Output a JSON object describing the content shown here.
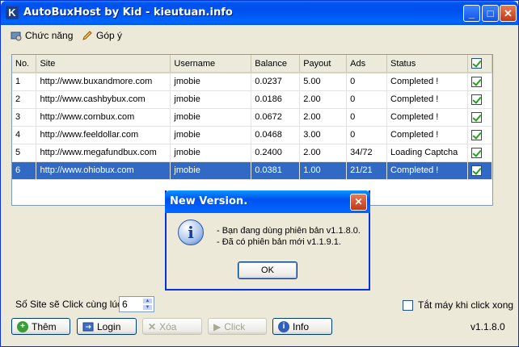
{
  "window": {
    "title": "AutoBuxHost by Kid - kieutuan.info",
    "icon_letter": "K"
  },
  "menu": {
    "items": [
      {
        "label": "Chức năng"
      },
      {
        "label": "Góp ý"
      }
    ]
  },
  "table": {
    "headers": [
      "No.",
      "Site",
      "Username",
      "Balance",
      "Payout",
      "Ads",
      "Status"
    ],
    "rows": [
      [
        "1",
        "http://www.buxandmore.com",
        "jmobie",
        "0.0237",
        "5.00",
        "0",
        "Completed !"
      ],
      [
        "2",
        "http://www.cashbybux.com",
        "jmobie",
        "0.0186",
        "2.00",
        "0",
        "Completed !"
      ],
      [
        "3",
        "http://www.cornbux.com",
        "jmobie",
        "0.0672",
        "2.00",
        "0",
        "Completed !"
      ],
      [
        "4",
        "http://www.feeldollar.com",
        "jmobie",
        "0.0468",
        "3.00",
        "0",
        "Completed !"
      ],
      [
        "5",
        "http://www.megafundbux.com",
        "jmobie",
        "0.2400",
        "2.00",
        "34/72",
        "Loading Captcha"
      ],
      [
        "6",
        "http://www.ohiobux.com",
        "jmobie",
        "0.0381",
        "1.00",
        "21/21",
        "Completed !"
      ]
    ],
    "selected_row": 6
  },
  "dialog": {
    "title": "New Version.",
    "line1": "- Bạn đang dùng phiên bản v1.1.8.0.",
    "line2": "- Đã có phiên bản mới v1.1.9.1.",
    "ok_label": "OK"
  },
  "footer": {
    "sites_label": "Số Site sẽ Click cùng lúc:",
    "sites_value": "6",
    "shutdown_label": "Tắt máy khi click xong",
    "buttons": {
      "add": "Thêm",
      "login": "Login",
      "delete": "Xóa",
      "click": "Click",
      "info": "Info"
    },
    "version": "v1.1.8.0"
  }
}
